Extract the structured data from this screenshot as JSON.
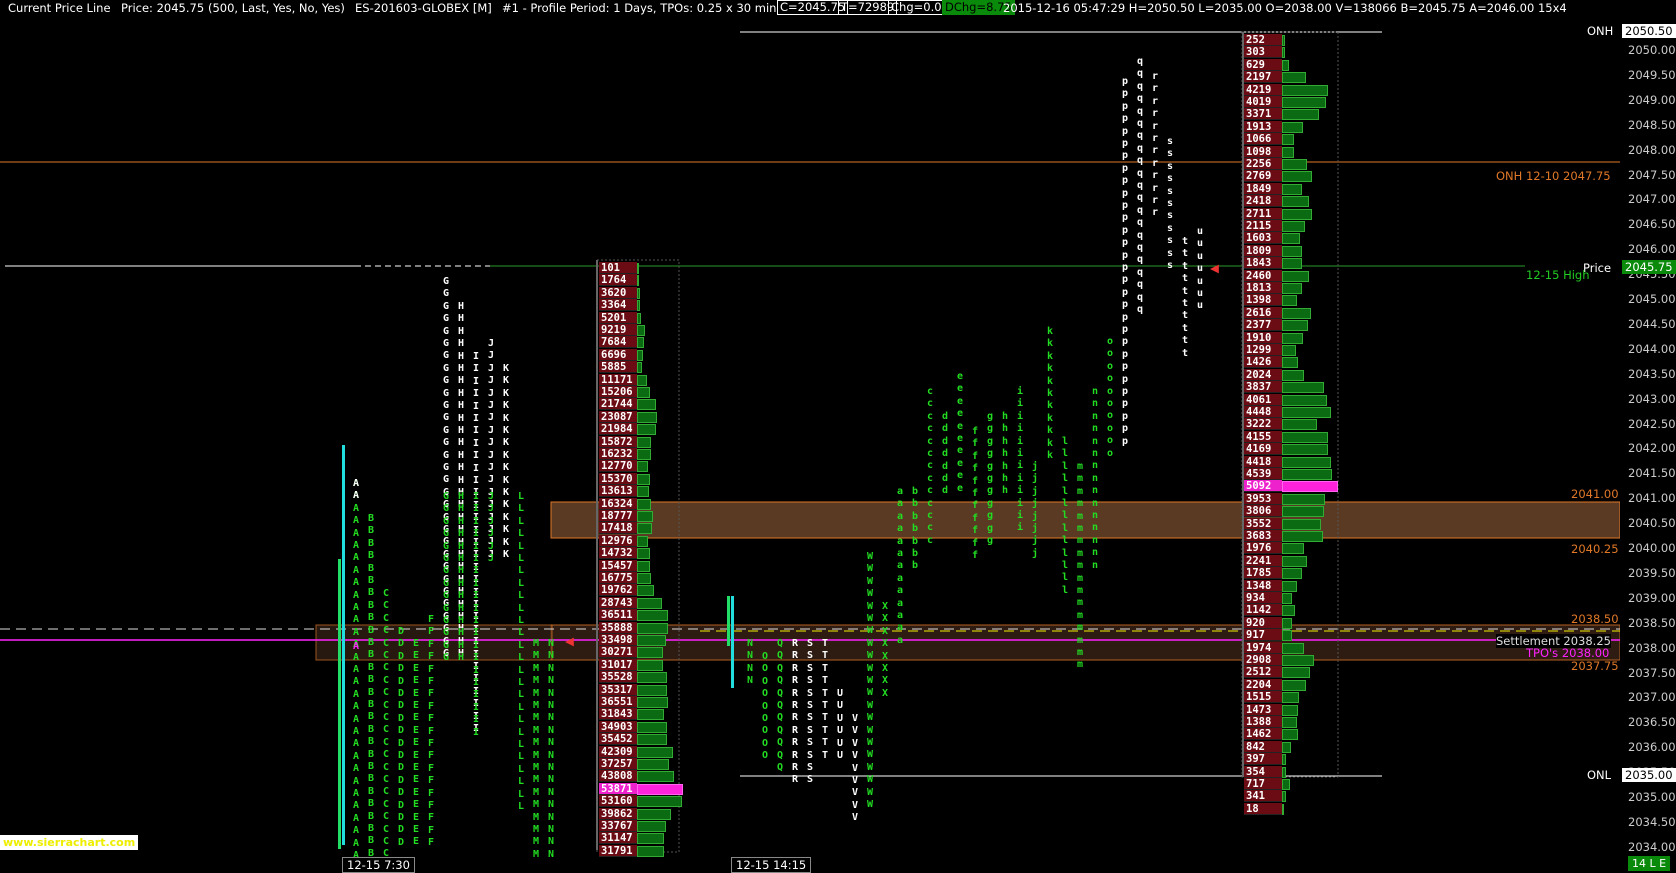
{
  "header": {
    "study": "Current Price Line",
    "price": "Price: 2045.75",
    "params": "(500, Last, Yes, No, Yes)",
    "symbol": "ES-201603-GLOBEX [M]",
    "profile": "#1 - Profile Period: 1 Days, TPOs: 0.25 x 30 min",
    "close": "C=2045.75",
    "ticks": "T=72989",
    "chg": "Chg=0.00",
    "dchg": "DChg=8.75",
    "stats": "2015-12-16 05:47:29 H=2050.50 L=2035.00 O=2038.00 V=138066 B=2045.75 A=2046.00 15x4"
  },
  "axis": {
    "ticks": [
      "2050.00",
      "2049.50",
      "2049.00",
      "2048.50",
      "2048.00",
      "2047.50",
      "2047.00",
      "2046.50",
      "2046.00",
      "2045.50",
      "2045.00",
      "2044.50",
      "2044.00",
      "2043.50",
      "2043.00",
      "2042.50",
      "2042.00",
      "2041.50",
      "2041.00",
      "2040.50",
      "2040.00",
      "2039.50",
      "2039.00",
      "2038.50",
      "2038.00",
      "2037.50",
      "2037.00",
      "2036.50",
      "2036.00",
      "2035.50",
      "2035.00",
      "2034.50",
      "2034.00"
    ],
    "high_box": "2050.50",
    "price_box": "2045.75",
    "low_box": "2035.00",
    "price_color": "#0a8a0a"
  },
  "levels": {
    "onh": "ONH",
    "onh1210": "ONH 12-10  2047.75",
    "price": "Price",
    "high1215": "12-15 High",
    "v2041": "2041.00",
    "v2040_25": "2040.25",
    "v2038_50": "2038.50",
    "settlement": "Settlement  2038.25",
    "tpos": "TPO's  2038.00",
    "v2037_75": "2037.75",
    "onl": "ONL"
  },
  "colors": {
    "orange": "#e07828",
    "green_text": "#22dd22",
    "yellow": "#ffee00",
    "magenta": "#ff22ff",
    "cyan": "#22dddd",
    "vol_bar": "#0b6b12",
    "vol_cell": "#6b0c14"
  },
  "profile1": {
    "vol": [
      "101",
      "1764",
      "3620",
      "3364",
      "5201",
      "9219",
      "7684",
      "6696",
      "5885",
      "11171",
      "15206",
      "21744",
      "23087",
      "21984",
      "15872",
      "16232",
      "12770",
      "15370",
      "13613",
      "16324",
      "18777",
      "17418",
      "12976",
      "14732",
      "15457",
      "16775",
      "19762",
      "28743",
      "36511",
      "35888",
      "33498",
      "30271",
      "31017",
      "35528",
      "35317",
      "36551",
      "31843",
      "34903",
      "35452",
      "42309",
      "37257",
      "43808",
      "53871",
      "53160",
      "39862",
      "33767",
      "31147",
      "31791"
    ],
    "poc": "53871"
  },
  "profile3": {
    "vol": [
      "252",
      "303",
      "629",
      "2197",
      "4219",
      "4019",
      "3371",
      "1913",
      "1066",
      "1098",
      "2256",
      "2769",
      "1849",
      "2418",
      "2711",
      "2115",
      "1603",
      "1809",
      "1843",
      "2460",
      "1813",
      "1398",
      "2616",
      "2377",
      "1910",
      "1299",
      "1426",
      "2024",
      "3837",
      "4061",
      "4448",
      "3222",
      "4155",
      "4169",
      "4418",
      "4539",
      "5092",
      "3953",
      "3806",
      "3552",
      "3683",
      "1976",
      "2241",
      "1785",
      "1348",
      "934",
      "1142",
      "920",
      "917",
      "1974",
      "2908",
      "2512",
      "2204",
      "1515",
      "1473",
      "1388",
      "1462",
      "842",
      "397",
      "354",
      "717",
      "341",
      "18"
    ],
    "poc": "5092"
  },
  "footer": {
    "watermark": "www.sierrachart.com",
    "time1": "12-15  7:30",
    "time2": "12-15  14:15",
    "status": "14 L E"
  }
}
